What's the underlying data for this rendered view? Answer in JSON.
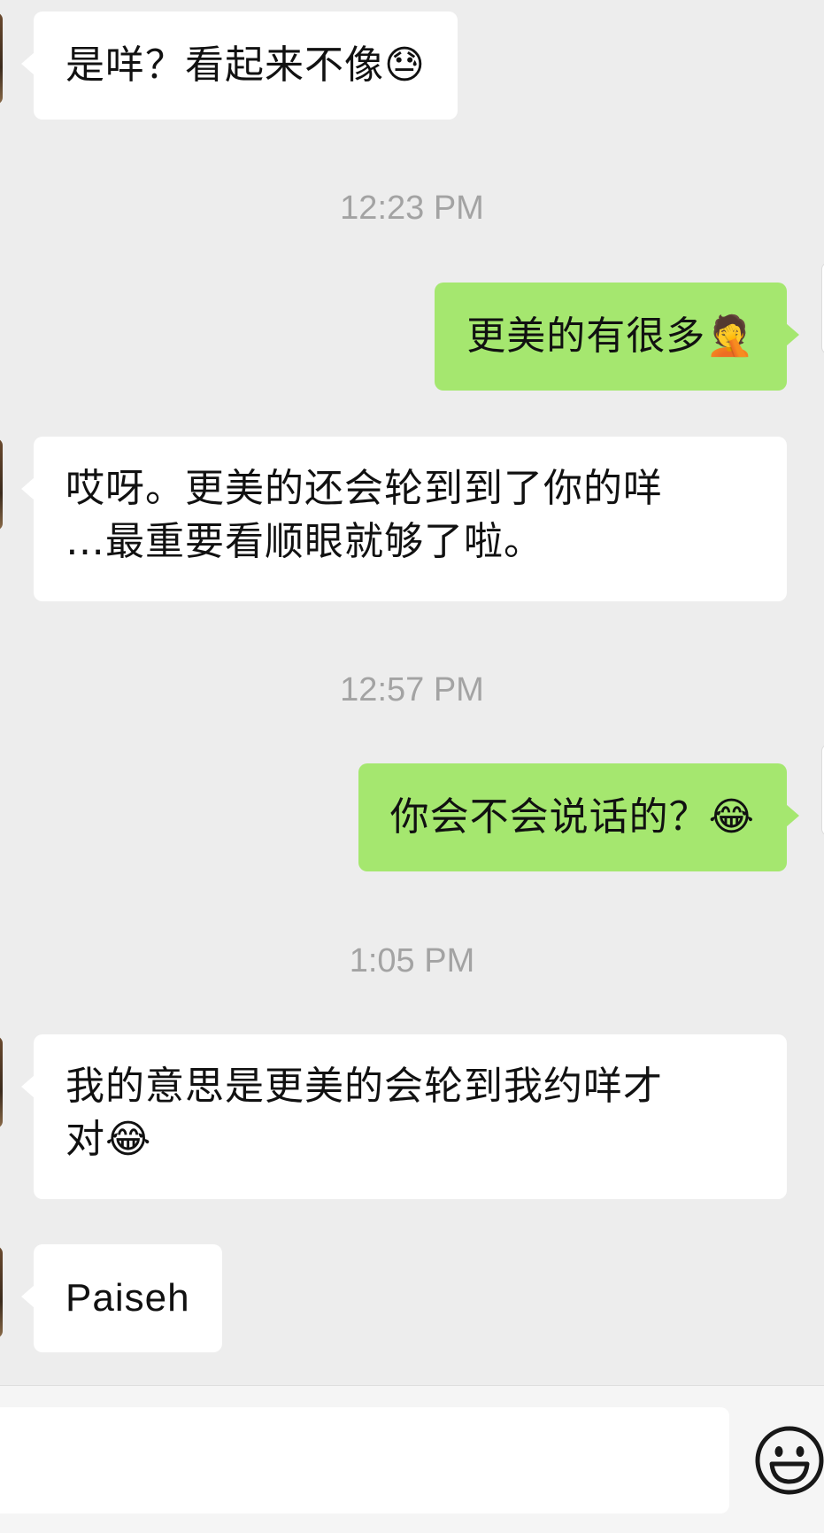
{
  "messages": [
    {
      "direction": "in",
      "text": "是咩？看起来不像",
      "emoji": "😓"
    },
    {
      "timestamp": "12:23 PM"
    },
    {
      "direction": "out",
      "text": "更美的有很多",
      "emoji": "🤦"
    },
    {
      "direction": "in",
      "line1": "哎呀。更美的还会轮到到了你的咩",
      "line2": "…最重要看顺眼就够了啦。"
    },
    {
      "timestamp": "12:57 PM"
    },
    {
      "direction": "out",
      "text": "你会不会说话的？",
      "emoji": "😂"
    },
    {
      "timestamp": "1:05 PM"
    },
    {
      "direction": "in",
      "line1": "我的意思是更美的会轮到我约咩才",
      "line2": "对",
      "emoji": "😂"
    },
    {
      "direction": "in",
      "text": "Paiseh"
    }
  ],
  "input": {
    "value": "",
    "placeholder": ""
  },
  "icons": {
    "emoji_button": "smiley-face-icon"
  },
  "colors": {
    "background": "#ededed",
    "incoming_bubble": "#ffffff",
    "outgoing_bubble": "#a5e76f",
    "timestamp": "#a3a3a3"
  }
}
